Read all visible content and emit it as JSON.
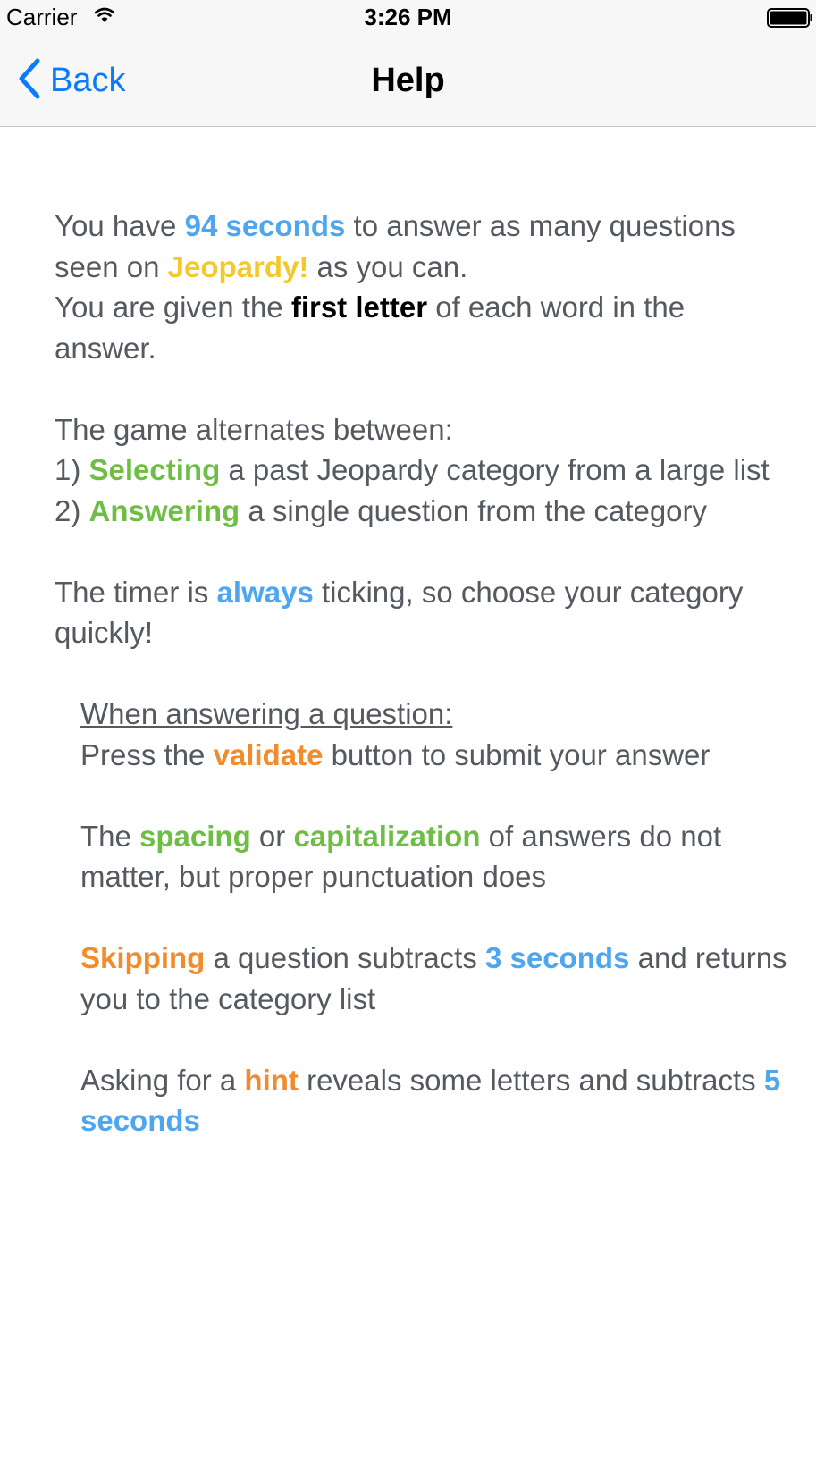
{
  "status_bar": {
    "carrier": "Carrier",
    "time": "3:26 PM"
  },
  "nav": {
    "back_label": "Back",
    "title": "Help"
  },
  "help": {
    "intro": {
      "t1": "You have ",
      "seconds": "94 seconds",
      "t2": " to answer as many questions seen on ",
      "jeopardy": "Jeopardy!",
      "t3": " as you can."
    },
    "letter": {
      "t1": "You are given the ",
      "first_letter": "first letter",
      "t2": " of each word in the answer."
    },
    "game_intro": "The game alternates between:",
    "step1": {
      "num": "1) ",
      "word": "Selecting",
      "rest": " a past Jeopardy category from a large list"
    },
    "step2": {
      "num": "2) ",
      "word": "Answering",
      "rest": " a single question from the category"
    },
    "timer": {
      "t1": "The timer is ",
      "always": "always",
      "t2": " ticking, so choose your category quickly!"
    },
    "answering_heading": "When answering a question:",
    "validate": {
      "t1": "Press the ",
      "word": "validate",
      "t2": " button to submit your answer"
    },
    "spacing": {
      "t1": "The ",
      "spacing": "spacing",
      "t2": " or ",
      "capitalization": "capitalization",
      "t3": " of answers do not matter, but proper punctuation does"
    },
    "skipping": {
      "word": "Skipping",
      "t1": " a question subtracts ",
      "seconds": "3 seconds",
      "t2": " and returns you to the category list"
    },
    "hint": {
      "t1": "Asking for a ",
      "word": "hint",
      "t2": " reveals some letters and subtracts ",
      "seconds": "5 seconds"
    }
  },
  "colors": {
    "accent_blue": "#0a7aff",
    "highlight_blue": "#4da6ee",
    "highlight_yellow": "#f4c82b",
    "highlight_green": "#6ebd45",
    "highlight_orange": "#f18c2c"
  }
}
